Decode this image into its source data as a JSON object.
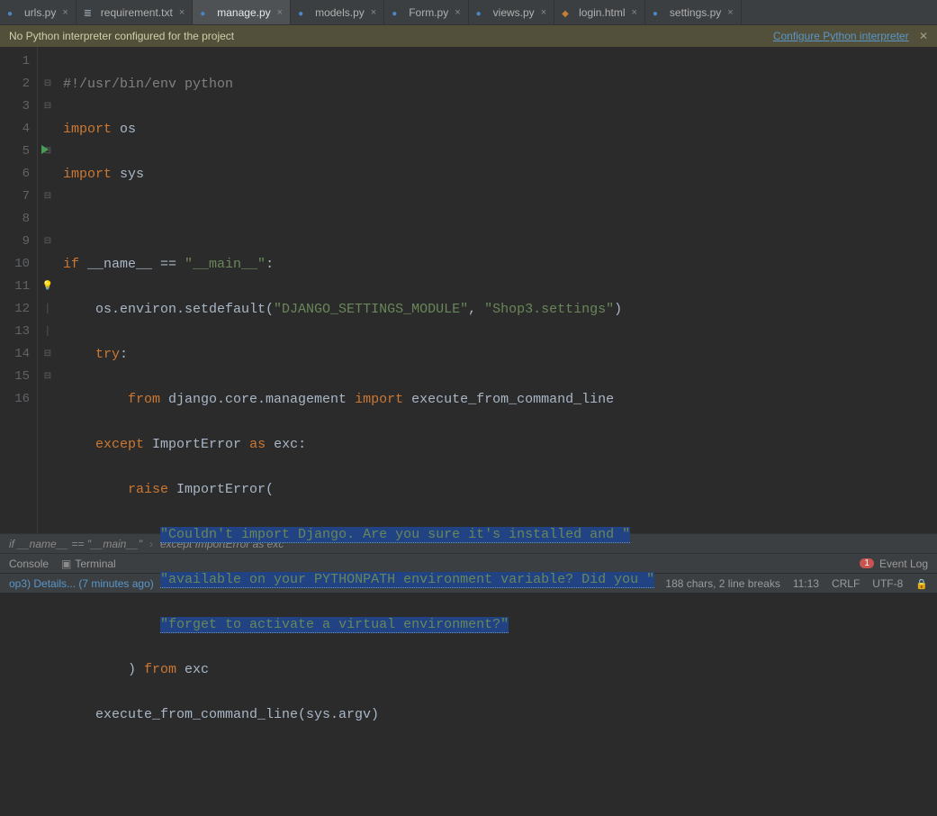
{
  "tabs": [
    {
      "label": "urls.py",
      "iconClass": "py-icon",
      "active": false
    },
    {
      "label": "requirement.txt",
      "iconClass": "txt-icon",
      "active": false
    },
    {
      "label": "manage.py",
      "iconClass": "py-icon",
      "active": true
    },
    {
      "label": "models.py",
      "iconClass": "py-icon",
      "active": false
    },
    {
      "label": "Form.py",
      "iconClass": "py-icon",
      "active": false
    },
    {
      "label": "views.py",
      "iconClass": "py-icon",
      "active": false
    },
    {
      "label": "login.html",
      "iconClass": "html-icon",
      "active": false
    },
    {
      "label": "settings.py",
      "iconClass": "py-icon",
      "active": false
    }
  ],
  "warn": {
    "text": "No Python interpreter configured for the project",
    "link": "Configure Python interpreter"
  },
  "gutter": [
    "1",
    "2",
    "3",
    "4",
    "5",
    "6",
    "7",
    "8",
    "9",
    "10",
    "11",
    "12",
    "13",
    "14",
    "15",
    "16"
  ],
  "code": {
    "l1_cmt": "#!/usr/bin/env python",
    "l2_a": "import ",
    "l2_b": "os",
    "l3_a": "import ",
    "l3_b": "sys",
    "l5_a": "if ",
    "l5_b": "__name__ == ",
    "l5_c": "\"__main__\"",
    "l5_d": ":",
    "l6_a": "    os.environ.setdefault(",
    "l6_b": "\"DJANGO_SETTINGS_MODULE\"",
    "l6_c": ", ",
    "l6_d": "\"Shop3.settings\"",
    "l6_e": ")",
    "l7_a": "    ",
    "l7_b": "try",
    "l7_c": ":",
    "l8_a": "        ",
    "l8_b": "from ",
    "l8_c": "django.core.management ",
    "l8_d": "import ",
    "l8_e": "execute_from_command_line",
    "l9_a": "    ",
    "l9_b": "except ",
    "l9_c": "ImportError ",
    "l9_d": "as ",
    "l9_e": "exc:",
    "l10_a": "        ",
    "l10_b": "raise ",
    "l10_c": "ImportError(",
    "l11_a": "            ",
    "l11_sel": "\"Couldn't import Django. Are you sure it's installed and \"",
    "l12_a": "            ",
    "l12_sel": "\"available on your PYTHONPATH environment variable? Did you \"",
    "l13_a": "            ",
    "l13_sel": "\"forget to activate a virtual environment?\"",
    "l14_a": "        ) ",
    "l14_b": "from ",
    "l14_c": "exc",
    "l15_a": "    execute_from_command_line(sys.argv)"
  },
  "crumbs": {
    "a": "if __name__ == \"__main__\"",
    "b": "except ImportError as exc"
  },
  "tools": {
    "console": "Console",
    "terminal": "Terminal",
    "eventlog": "Event Log",
    "badge": "1"
  },
  "status": {
    "msg": "op3) Details... (7 minutes ago)",
    "chars": "188 chars, 2 line breaks",
    "pos": "11:13",
    "eol": "CRLF",
    "enc": "UTF-8"
  }
}
